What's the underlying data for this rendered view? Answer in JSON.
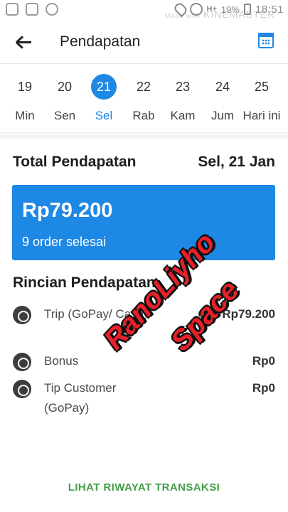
{
  "statusbar": {
    "signal": "H+",
    "battery": "19%",
    "time": "18:51",
    "watermark_small": "Made with",
    "watermark": "KINEMASTER"
  },
  "appbar": {
    "title": "Pendapatan"
  },
  "dates": [
    {
      "num": "19",
      "label": "Min",
      "selected": false
    },
    {
      "num": "20",
      "label": "Sen",
      "selected": false
    },
    {
      "num": "21",
      "label": "Sel",
      "selected": true
    },
    {
      "num": "22",
      "label": "Rab",
      "selected": false
    },
    {
      "num": "23",
      "label": "Kam",
      "selected": false
    },
    {
      "num": "24",
      "label": "Jum",
      "selected": false
    },
    {
      "num": "25",
      "label": "Hari ini",
      "selected": false
    }
  ],
  "summary": {
    "label": "Total Pendapatan",
    "date": "Sel, 21 Jan",
    "amount": "Rp79.200",
    "orders": "9 order selesai"
  },
  "breakdown": {
    "title": "Rincian Pendapatan",
    "items": [
      {
        "name": "Trip (GoPay/ Cash)",
        "amount": "Rp79.200"
      },
      {
        "name": "Bonus",
        "amount": "Rp0"
      },
      {
        "name": "Tip Customer (GoPay)",
        "amount": "Rp0"
      }
    ]
  },
  "overlay": {
    "line1": "RanoLiyho",
    "line2": "Space"
  },
  "footer": {
    "history_link": "LIHAT RIWAYAT TRANSAKSI"
  },
  "colors": {
    "accent": "#1e88e5",
    "link": "#43a047",
    "overlay": "#e8202a"
  }
}
